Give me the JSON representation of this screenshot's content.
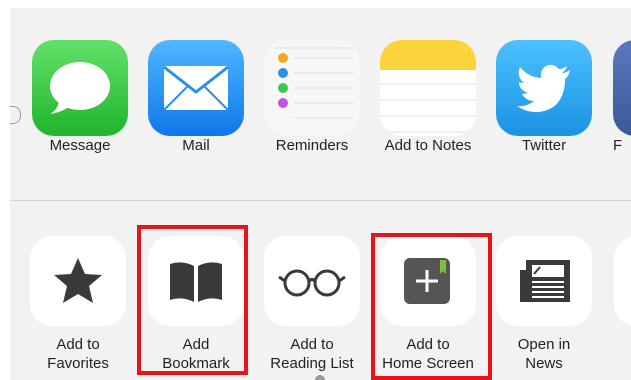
{
  "share_sheet": {
    "apps": [
      {
        "label": "Message",
        "icon": "message-icon"
      },
      {
        "label": "Mail",
        "icon": "mail-icon"
      },
      {
        "label": "Reminders",
        "icon": "reminders-icon"
      },
      {
        "label": "Add to Notes",
        "icon": "notes-icon"
      },
      {
        "label": "Twitter",
        "icon": "twitter-icon"
      },
      {
        "label": "F",
        "icon": "facebook-icon"
      }
    ],
    "actions": [
      {
        "line1": "Add to",
        "line2": "Favorites",
        "icon": "star-icon"
      },
      {
        "line1": "Add",
        "line2": "Bookmark",
        "icon": "book-icon",
        "highlighted": true
      },
      {
        "line1": "Add to",
        "line2": "Reading List",
        "icon": "glasses-icon"
      },
      {
        "line1": "Add to",
        "line2": "Home Screen",
        "icon": "add-square-icon",
        "highlighted": true
      },
      {
        "line1": "Open in",
        "line2": "News",
        "icon": "news-icon"
      }
    ]
  },
  "colors": {
    "highlight": "#e8141c",
    "message_green": "#3cc84a",
    "mail_blue": "#1e8ef2",
    "twitter_blue": "#2aa1e8",
    "notes_yellow": "#fdd33b"
  }
}
